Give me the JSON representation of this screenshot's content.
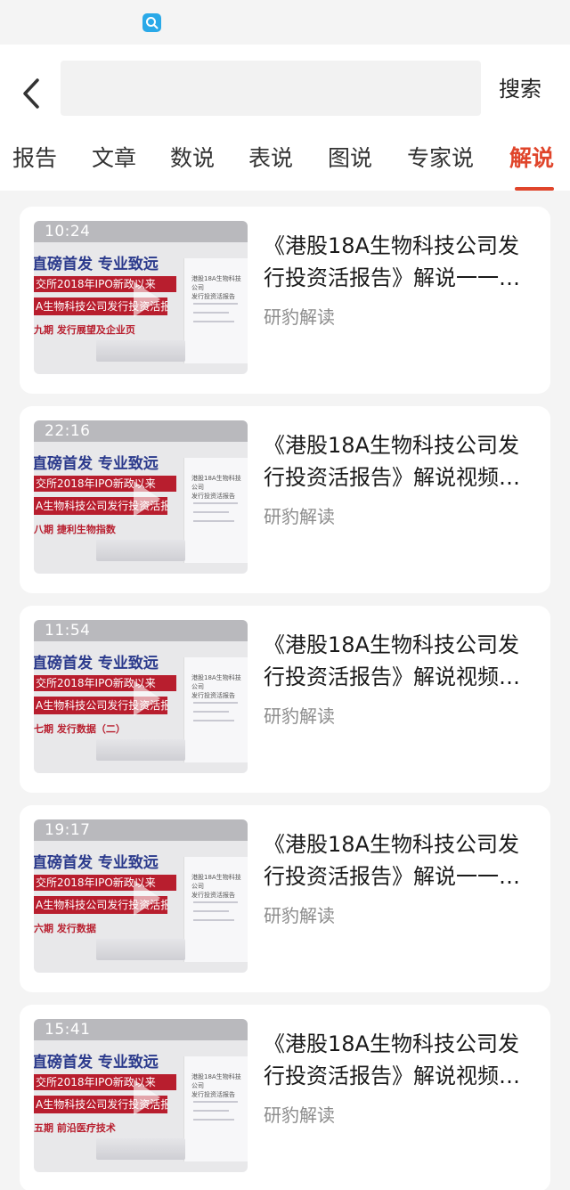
{
  "search": {
    "value": "",
    "button_label": "搜索"
  },
  "tabs": [
    {
      "label": "报告",
      "active": false
    },
    {
      "label": "文章",
      "active": false
    },
    {
      "label": "数说",
      "active": false
    },
    {
      "label": "表说",
      "active": false
    },
    {
      "label": "图说",
      "active": false
    },
    {
      "label": "专家说",
      "active": false
    },
    {
      "label": "解说",
      "active": true
    }
  ],
  "colors": {
    "accent": "#e0452b",
    "thumb_red": "#b81e2e",
    "thumb_blue": "#2b3a8c"
  },
  "thumbnail": {
    "slogan": "直磅首发 专业致远",
    "line1": "交所2018年IPO新政以来",
    "line2": "A生物科技公司发行投资活报告"
  },
  "items": [
    {
      "duration": "10:24",
      "title_line1": "《港股18A生物科技公司发",
      "title_line2": "行投资活报告》解说一一…",
      "source": "研豹解读",
      "episode": "九期 发行展望及企业页"
    },
    {
      "duration": "22:16",
      "title_line1": "《港股18A生物科技公司发",
      "title_line2": "行投资活报告》解说视频…",
      "source": "研豹解读",
      "episode": "八期 捷利生物指数"
    },
    {
      "duration": "11:54",
      "title_line1": "《港股18A生物科技公司发",
      "title_line2": "行投资活报告》解说视频…",
      "source": "研豹解读",
      "episode": "七期 发行数据（二）"
    },
    {
      "duration": "19:17",
      "title_line1": "《港股18A生物科技公司发",
      "title_line2": "行投资活报告》解说一一…",
      "source": "研豹解读",
      "episode": "六期 发行数据"
    },
    {
      "duration": "15:41",
      "title_line1": "《港股18A生物科技公司发",
      "title_line2": "行投资活报告》解说视频…",
      "source": "研豹解读",
      "episode": "五期 前沿医疗技术"
    }
  ]
}
